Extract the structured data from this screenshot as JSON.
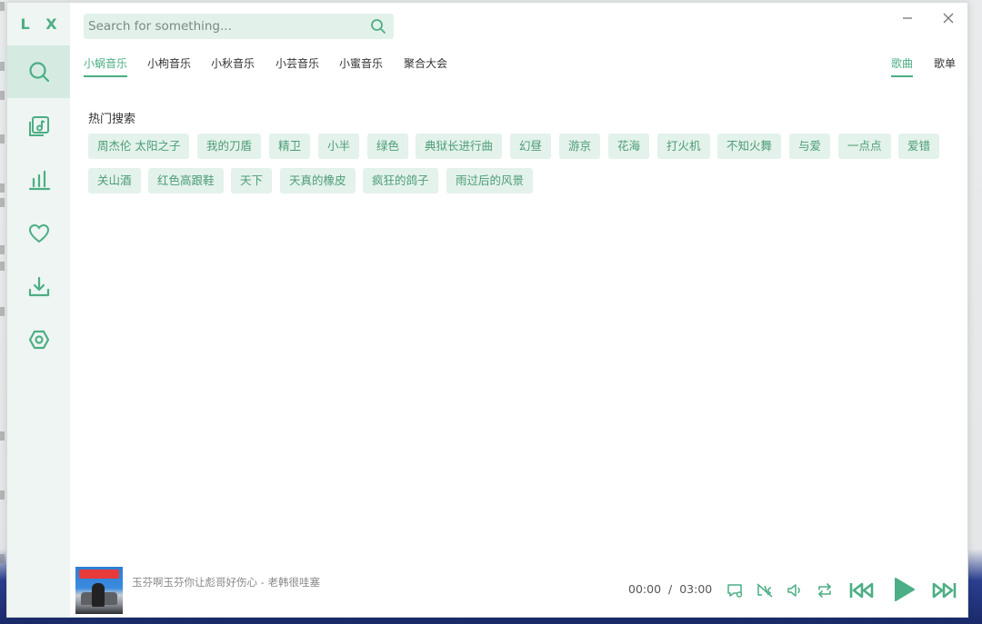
{
  "app": {
    "logo": "L X"
  },
  "search": {
    "placeholder": "Search for something..."
  },
  "sources": [
    {
      "label": "小蜗音乐",
      "active": true
    },
    {
      "label": "小枸音乐",
      "active": false
    },
    {
      "label": "小秋音乐",
      "active": false
    },
    {
      "label": "小芸音乐",
      "active": false
    },
    {
      "label": "小蜜音乐",
      "active": false
    },
    {
      "label": "聚合大会",
      "active": false
    }
  ],
  "type_tabs": [
    {
      "label": "歌曲",
      "active": true
    },
    {
      "label": "歌单",
      "active": false
    }
  ],
  "hot_search": {
    "title": "热门搜索",
    "tags": [
      "周杰伦 太阳之子",
      "我的刀盾",
      "精卫",
      "小半",
      "绿色",
      "典狱长进行曲",
      "幻昼",
      "游京",
      "花海",
      "打火机",
      "不知火舞",
      "与爱",
      "一点点",
      "爱错",
      "关山酒",
      "红色高跟鞋",
      "天下",
      "天真的橡皮",
      "疯狂的鸽子",
      "雨过后的风景"
    ]
  },
  "player": {
    "song": "玉芬啊玉芬你让彪哥好伤心 - 老韩很哇塞",
    "current_time": "00:00",
    "separator": "/",
    "duration": "03:00"
  },
  "colors": {
    "accent": "#4cae84",
    "tag_bg": "#e3f2ea",
    "sidebar_bg": "#eef5f2"
  }
}
